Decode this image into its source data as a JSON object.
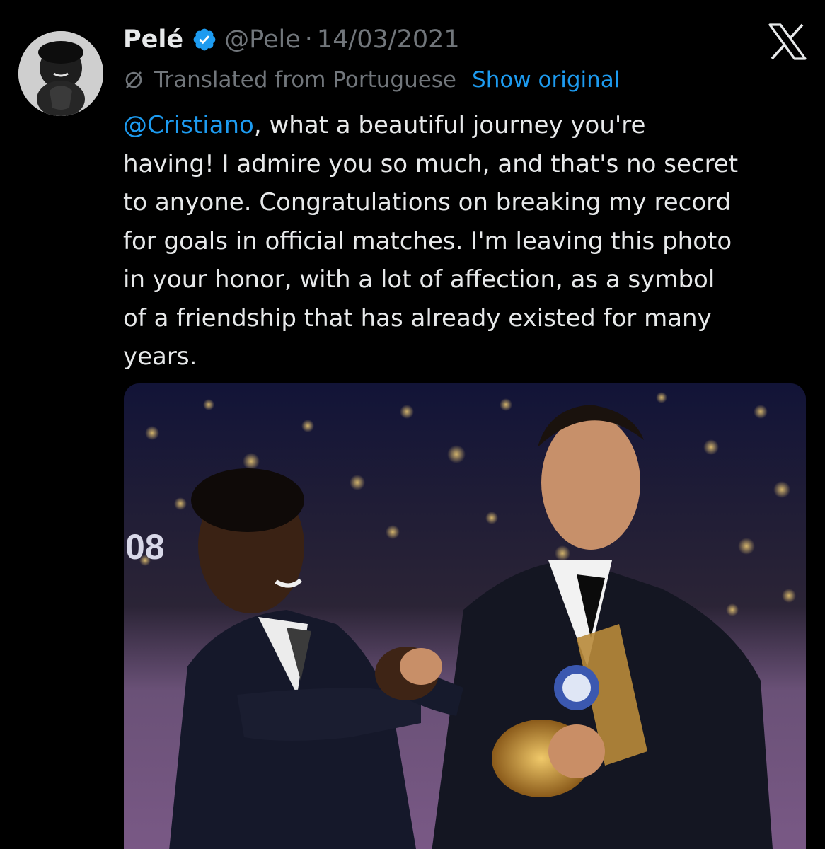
{
  "tweet": {
    "author_name": "Pelé",
    "handle": "@Pele",
    "separator": "·",
    "date": "14/03/2021",
    "translation_label": "Translated from Portuguese",
    "show_original_label": "Show original",
    "mention": "@Cristiano",
    "text_lines": [
      ", what a beautiful journey you're",
      "having! I admire you so much, and that's no secret",
      "to anyone. Congratulations on breaking my record",
      "for goals in official matches. I'm leaving this photo",
      "in your honor, with a lot of affection, as a symbol",
      "of a friendship that has already existed for many",
      "years."
    ],
    "media_backdrop_text": "08"
  },
  "icons": {
    "verified": "verified-badge-icon",
    "translate": "translate-icon",
    "logo": "x-logo-icon"
  },
  "colors": {
    "background": "#000000",
    "primary_text": "#e7e9ea",
    "secondary_text": "#71767b",
    "link": "#1d9bf0"
  }
}
